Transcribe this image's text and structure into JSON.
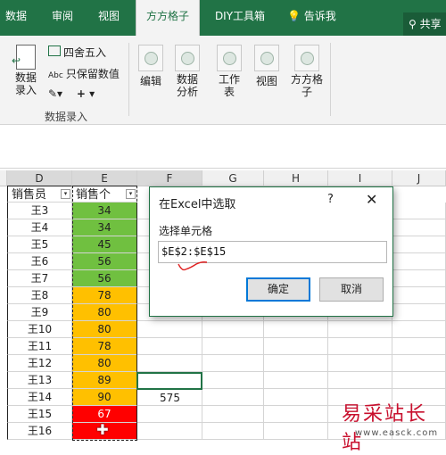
{
  "ribbon_tabs": [
    {
      "label": "数据"
    },
    {
      "label": "审阅"
    },
    {
      "label": "视图"
    },
    {
      "label": "方方格子",
      "active": true
    },
    {
      "label": "DIY工具箱"
    }
  ],
  "tell_me": "告诉我",
  "share": "共享",
  "ribbon": {
    "data_entry": "数据录入",
    "round": "四舍五入",
    "keep_values": "只保留数值",
    "group_label": "数据录入",
    "edit": "编辑",
    "analysis": "数据分析",
    "worksheet": "工作表",
    "view": "视图",
    "ffgz": "方方格子"
  },
  "grid": {
    "col_headers": [
      "D",
      "E",
      "F",
      "G",
      "H",
      "I",
      "J"
    ],
    "header_row": {
      "d": "销售员",
      "e": "销售个"
    },
    "rows": [
      {
        "name": "王3",
        "value": "34",
        "color": "#70c040"
      },
      {
        "name": "王4",
        "value": "34",
        "color": "#70c040"
      },
      {
        "name": "王5",
        "value": "45",
        "color": "#70c040"
      },
      {
        "name": "王6",
        "value": "56",
        "color": "#70c040"
      },
      {
        "name": "王7",
        "value": "56",
        "color": "#70c040"
      },
      {
        "name": "王8",
        "value": "78",
        "color": "#ffc000"
      },
      {
        "name": "王9",
        "value": "80",
        "color": "#ffc000"
      },
      {
        "name": "王10",
        "value": "80",
        "color": "#ffc000"
      },
      {
        "name": "王11",
        "value": "78",
        "color": "#ffc000"
      },
      {
        "name": "王12",
        "value": "80",
        "color": "#ffc000"
      },
      {
        "name": "王13",
        "value": "89",
        "color": "#ffc000"
      },
      {
        "name": "王14",
        "value": "90",
        "color": "#ffc000"
      },
      {
        "name": "王15",
        "value": "67",
        "color": "#ff0000"
      },
      {
        "name": "王16",
        "value": "",
        "color": "#ff0000"
      }
    ],
    "f_value": "575"
  },
  "dialog": {
    "title": "在Excel中选取",
    "help": "?",
    "close": "✕",
    "label": "选择单元格",
    "value": "$E$2:$E$15",
    "ok": "确定",
    "cancel": "取消"
  },
  "watermark": {
    "title": "易采站长站",
    "url": "www.easck.com"
  }
}
